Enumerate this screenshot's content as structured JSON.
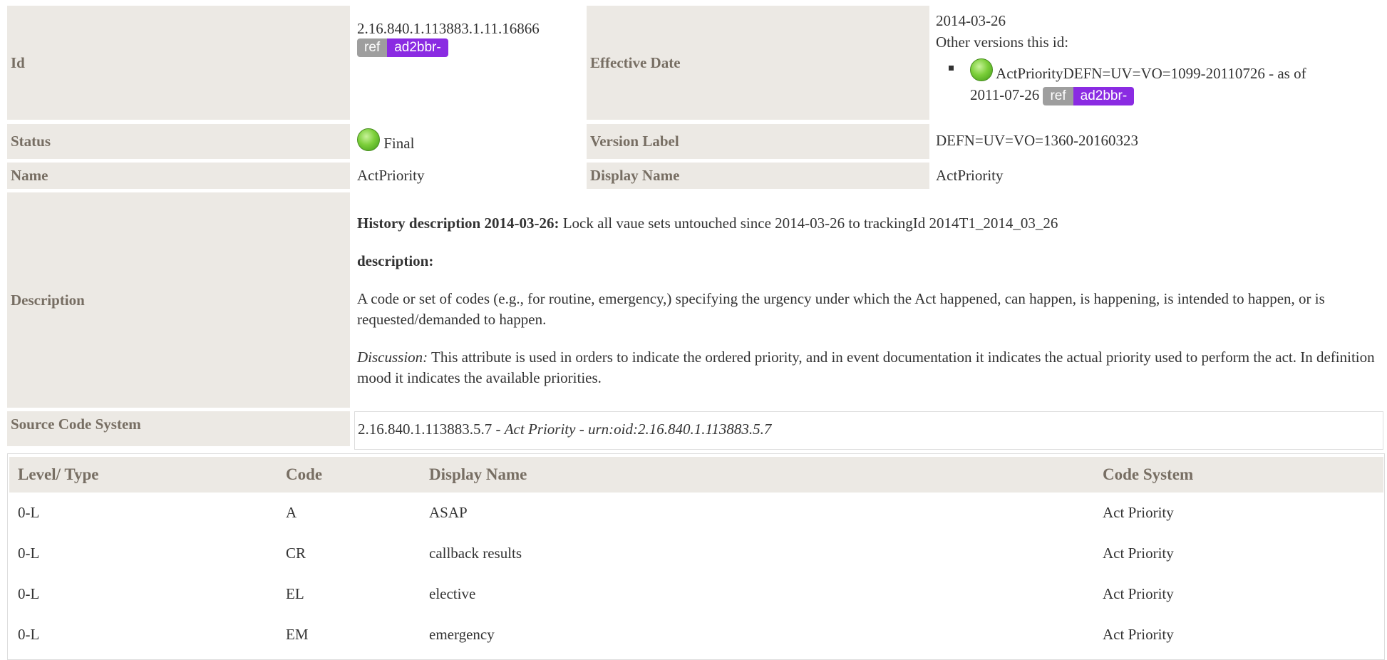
{
  "id": {
    "label": "Id",
    "value": "2.16.840.1.113883.1.11.16866",
    "badge_ref": "ref",
    "badge_prefix": "ad2bbr-"
  },
  "effective_date": {
    "label": "Effective Date",
    "value": "2014-03-26",
    "other_versions_label": "Other versions this id:",
    "other_versions": [
      {
        "name": "ActPriorityDEFN=UV=VO=1099-20110726",
        "as_of_text": " - as of",
        "date": "2011-07-26",
        "badge_ref": "ref",
        "badge_prefix": "ad2bbr-",
        "status": "final"
      }
    ]
  },
  "status": {
    "label": "Status",
    "value": "Final",
    "icon": "status-final-icon"
  },
  "version_label": {
    "label": "Version Label",
    "value": "DEFN=UV=VO=1360-20160323"
  },
  "name": {
    "label": "Name",
    "value": "ActPriority"
  },
  "display_name": {
    "label": "Display Name",
    "value": "ActPriority"
  },
  "description": {
    "label": "Description",
    "history_title": "History description 2014-03-26:",
    "history_text": " Lock all vaue sets untouched since 2014-03-26 to trackingId 2014T1_2014_03_26",
    "desc_title": "description:",
    "desc_text": "A code or set of codes (e.g., for routine, emergency,) specifying the urgency under which the Act happened, can happen, is happening, is intended to happen, or is requested/demanded to happen.",
    "discussion_title": "Discussion:",
    "discussion_text": " This attribute is used in orders to indicate the ordered priority, and in event documentation it indicates the actual priority used to perform the act. In definition mood it indicates the available priorities."
  },
  "source_code_system": {
    "label": "Source Code System",
    "oid": "2.16.840.1.113883.5.7",
    "sep1": " - ",
    "name": "Act Priority",
    "sep2": " - ",
    "urn": "urn:oid:2.16.840.1.113883.5.7"
  },
  "codes_table": {
    "headers": [
      "Level/ Type",
      "Code",
      "Display Name",
      "Code System"
    ],
    "rows": [
      [
        "0-L",
        "A",
        "ASAP",
        "Act Priority"
      ],
      [
        "0-L",
        "CR",
        "callback results",
        "Act Priority"
      ],
      [
        "0-L",
        "EL",
        "elective",
        "Act Priority"
      ],
      [
        "0-L",
        "EM",
        "emergency",
        "Act Priority"
      ]
    ]
  },
  "colors": {
    "label_bg": "#ece9e4",
    "label_text": "#776e63",
    "badge_ref": "#9e9e9e",
    "badge_prefix": "#8a2be2",
    "status_final": "#7ccf3a"
  }
}
